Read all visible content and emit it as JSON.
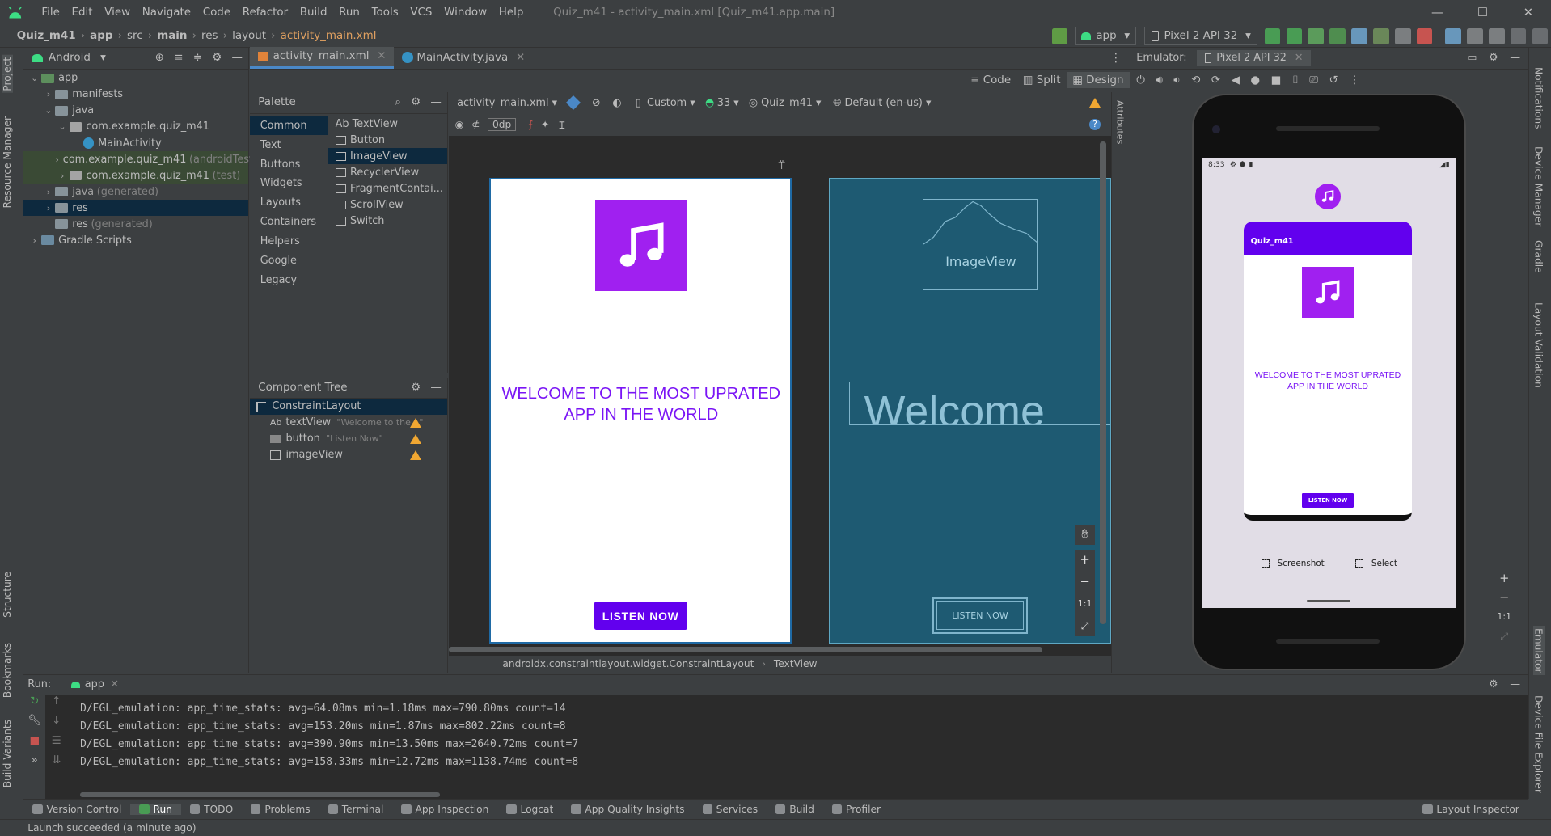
{
  "window": {
    "title": "Quiz_m41 - activity_main.xml [Quiz_m41.app.main]",
    "menu": [
      "File",
      "Edit",
      "View",
      "Navigate",
      "Code",
      "Refactor",
      "Build",
      "Run",
      "Tools",
      "VCS",
      "Window",
      "Help"
    ]
  },
  "breadcrumb": [
    "Quiz_m41",
    "app",
    "src",
    "main",
    "res",
    "layout",
    "activity_main.xml"
  ],
  "toolbar": {
    "run_config": "app",
    "device": "Pixel 2 API 32"
  },
  "project": {
    "view": "Android",
    "tree": [
      {
        "label": "app",
        "depth": 0,
        "open": true
      },
      {
        "label": "manifests",
        "depth": 1,
        "open": false
      },
      {
        "label": "java",
        "depth": 1,
        "open": true
      },
      {
        "label": "com.example.quiz_m41",
        "depth": 2,
        "open": true
      },
      {
        "label": "MainActivity",
        "depth": 3
      },
      {
        "label": "com.example.quiz_m41",
        "suffix": "(androidTest)",
        "depth": 2,
        "open": false
      },
      {
        "label": "com.example.quiz_m41",
        "suffix": "(test)",
        "depth": 2,
        "open": false
      },
      {
        "label": "java",
        "suffix": "(generated)",
        "depth": 1,
        "open": false
      },
      {
        "label": "res",
        "depth": 1,
        "open": false
      },
      {
        "label": "res",
        "suffix": "(generated)",
        "depth": 1
      },
      {
        "label": "Gradle Scripts",
        "depth": 0,
        "open": false
      }
    ]
  },
  "side_tabs_left": [
    "Project",
    "Resource Manager",
    "Structure",
    "Bookmarks",
    "Build Variants"
  ],
  "side_tabs_right": [
    "Notifications",
    "Device Manager",
    "Gradle",
    "Layout Validation",
    "Emulator",
    "Device File Explorer"
  ],
  "editor_tabs": [
    "activity_main.xml",
    "MainActivity.java"
  ],
  "view_modes": [
    "Code",
    "Split",
    "Design"
  ],
  "palette": {
    "title": "Palette",
    "categories": [
      "Common",
      "Text",
      "Buttons",
      "Widgets",
      "Layouts",
      "Containers",
      "Helpers",
      "Google",
      "Legacy"
    ],
    "items": [
      "Ab TextView",
      "Button",
      "ImageView",
      "RecyclerView",
      "FragmentContai...",
      "ScrollView",
      "Switch"
    ]
  },
  "design_toolbar": {
    "file": "activity_main.xml",
    "theme": "Custom",
    "api": "33",
    "module": "Quiz_m41",
    "locale": "Default (en-us)",
    "margin": "0dp"
  },
  "component_tree": {
    "title": "Component Tree",
    "root": "ConstraintLayout",
    "children": [
      {
        "type": "Ab",
        "name": "textView",
        "hint": "\"Welcome to the...\""
      },
      {
        "name": "button",
        "hint": "\"Listen Now\""
      },
      {
        "name": "imageView",
        "hint": ""
      }
    ]
  },
  "design": {
    "welcome_text": "WELCOME TO THE MOST UPRATED APP IN THE WORLD",
    "button_label": "LISTEN NOW",
    "blueprint_image_label": "ImageView",
    "blueprint_welcome": "Welcome",
    "blueprint_button": "LISTEN NOW",
    "zoom_label": "1:1"
  },
  "bottom_path": [
    "androidx.constraintlayout.widget.ConstraintLayout",
    "TextView"
  ],
  "emulator": {
    "label": "Emulator:",
    "tab": "Pixel 2 API 32",
    "status_time": "8:33",
    "app_title": "Quiz_m41",
    "screenshot": "Screenshot",
    "select": "Select",
    "zoom_label": "1:1"
  },
  "run": {
    "label": "Run:",
    "config": "app",
    "logs": [
      "D/EGL_emulation: app_time_stats: avg=64.08ms min=1.18ms max=790.80ms count=14",
      "D/EGL_emulation: app_time_stats: avg=153.20ms min=1.87ms max=802.22ms count=8",
      "D/EGL_emulation: app_time_stats: avg=390.90ms min=13.50ms max=2640.72ms count=7",
      "D/EGL_emulation: app_time_stats: avg=158.33ms min=12.72ms max=1138.74ms count=8"
    ]
  },
  "bottom_tabs": [
    "Version Control",
    "Run",
    "TODO",
    "Problems",
    "Terminal",
    "App Inspection",
    "Logcat",
    "App Quality Insights",
    "Services",
    "Build",
    "Profiler"
  ],
  "layout_inspector": "Layout Inspector",
  "status": "Launch succeeded (a minute ago)",
  "colors": {
    "accent": "#6200ee",
    "icon_purple": "#a020f0",
    "blueprint": "#1e5a72",
    "selection": "#0d293e"
  }
}
